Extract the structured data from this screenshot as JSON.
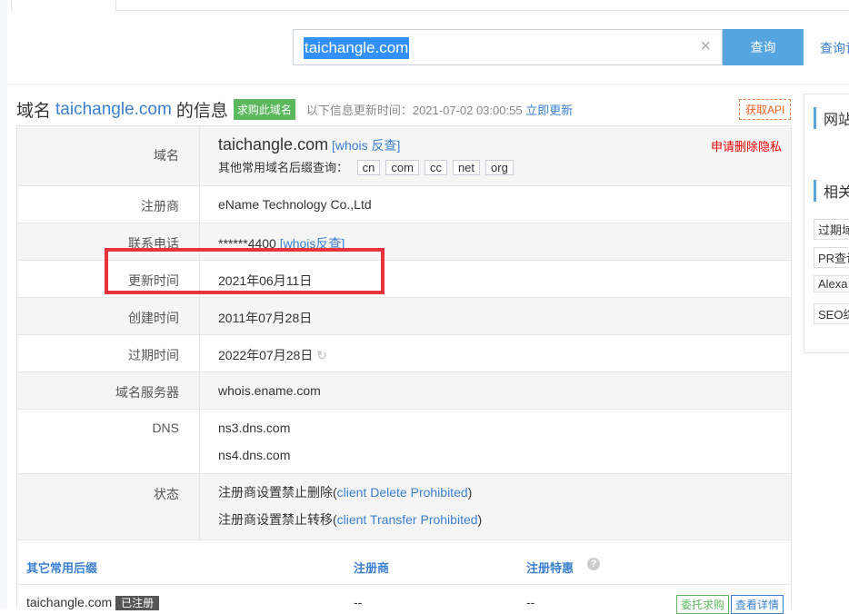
{
  "search": {
    "value": "taichangle.com",
    "clear_icon": "×",
    "button": "查询",
    "link": "查询记"
  },
  "header": {
    "prefix": "域名",
    "domain": "taichangle.com",
    "suffix": "的信息",
    "buy_tag": "求购此域名",
    "update_label": "以下信息更新时间：2021-07-02 03:00:55",
    "refresh": "立即更新",
    "api": "获取API"
  },
  "rows": {
    "domain": {
      "label": "域名",
      "value": "taichangle.com",
      "whois": "[whois 反查]",
      "privacy": "申请删除隐私",
      "suffix_label": "其他常用域名后缀查询：",
      "suffixes": [
        "cn",
        "com",
        "cc",
        "net",
        "org"
      ]
    },
    "registrar": {
      "label": "注册商",
      "value": "eName Technology Co.,Ltd"
    },
    "phone": {
      "label": "联系电话",
      "value": "******4400",
      "whois": "[whois反查]"
    },
    "updated": {
      "label": "更新时间",
      "value": "2021年06月11日"
    },
    "created": {
      "label": "创建时间",
      "value": "2011年07月28日"
    },
    "expires": {
      "label": "过期时间",
      "value": "2022年07月28日"
    },
    "server": {
      "label": "域名服务器",
      "value": "whois.ename.com"
    },
    "dns": {
      "label": "DNS",
      "values": [
        "ns3.dns.com",
        "ns4.dns.com"
      ]
    },
    "status": {
      "label": "状态",
      "items": [
        {
          "cn": "注册商设置禁止删除",
          "open": "(",
          "en": "client Delete Prohibited",
          "close": ")"
        },
        {
          "cn": "注册商设置禁止转移",
          "open": "(",
          "en": "client Transfer Prohibited",
          "close": ")"
        }
      ]
    }
  },
  "other": {
    "headers": [
      "其它常用后缀",
      "注册商",
      "注册特惠"
    ],
    "help_icon": "?",
    "row": {
      "domain": "taichangle.com",
      "badge": "已注册",
      "registrar": "--",
      "promo": "--",
      "buy": "委托求购",
      "detail": "查看详情"
    }
  },
  "sidebar": {
    "h1": "网站",
    "h2": "相关",
    "items": [
      "过期域",
      "PR查询",
      "Alexa",
      "SEO综"
    ]
  }
}
